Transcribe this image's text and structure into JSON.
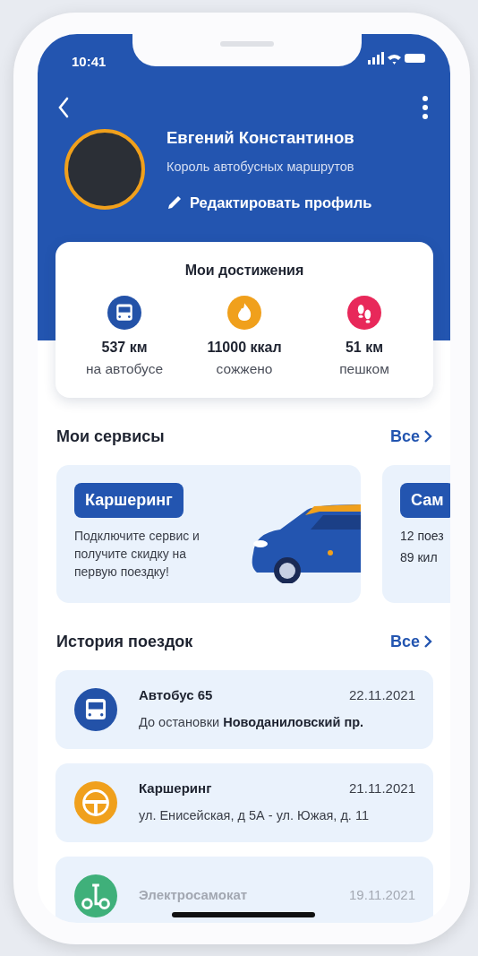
{
  "status_bar": {
    "time": "10:41"
  },
  "profile": {
    "name": "Евгений Константинов",
    "subtitle": "Король автобусных маршрутов",
    "edit_label": "Редактировать профиль"
  },
  "achievements": {
    "title": "Мои достижения",
    "items": [
      {
        "kind": "bus",
        "color": "#2352a8",
        "value": "537 км",
        "label": "на автобусе"
      },
      {
        "kind": "fire",
        "color": "#f0a01c",
        "value": "11000 ккал",
        "label": "сожжено"
      },
      {
        "kind": "steps",
        "color": "#e8285a",
        "value": "51 км",
        "label": "пешком"
      }
    ]
  },
  "services": {
    "title": "Мои сервисы",
    "all_label": "Все",
    "cards": [
      {
        "kind": "promo",
        "title": "Каршеринг",
        "text": "Подключите сервис и получите скидку на первую поездку!"
      },
      {
        "kind": "stats",
        "title": "Сам",
        "lines": [
          "12 поез",
          "89 кил"
        ]
      }
    ]
  },
  "history": {
    "title": "История поездок",
    "all_label": "Все",
    "trips": [
      {
        "kind": "bus",
        "color": "#2352a8",
        "title": "Автобус 65",
        "date": "22.11.2021",
        "detail": "До остановки **Новоданиловский пр.**",
        "faded": false
      },
      {
        "kind": "car",
        "color": "#f0a01c",
        "title": "Каршеринг",
        "date": "21.11.2021",
        "detail": "ул. Енисейская, д 5А - ул. Южая, д. 11",
        "faded": false
      },
      {
        "kind": "scooter",
        "color": "#3fb07a",
        "title": "Электросамокат",
        "date": "19.11.2021",
        "faded": true
      }
    ]
  }
}
